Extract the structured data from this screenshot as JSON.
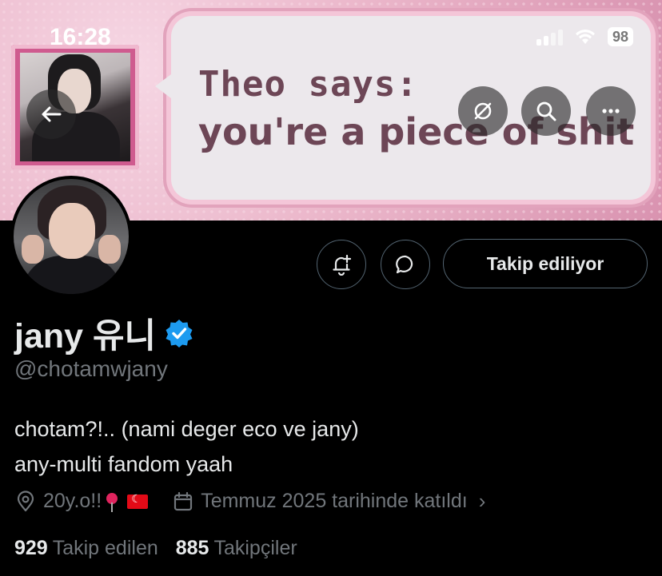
{
  "status_bar": {
    "time": "16:28",
    "battery": "98"
  },
  "banner": {
    "line1": "Theo says:",
    "line2": "you're a piece of shit"
  },
  "header_buttons": {
    "back_icon": "arrow-left-icon",
    "translate_icon": "grok-icon",
    "search_icon": "search-icon",
    "more_icon": "more-icon"
  },
  "actions": {
    "notify_icon": "bell-plus-icon",
    "message_icon": "message-bubble-icon",
    "follow_label": "Takip ediliyor"
  },
  "profile": {
    "display_name": "jany 유니",
    "verified": true,
    "handle": "@chotamwjany",
    "bio_line1": "chotam?!.. (nami deger eco ve jany)",
    "bio_line2": "any-multi fandom yaah",
    "location": "20y.o!!",
    "joined": "Temmuz 2025 tarihinde katıldı"
  },
  "stats": {
    "following_count": "929",
    "following_label": "Takip edilen",
    "followers_count": "885",
    "followers_label": "Takipçiler"
  },
  "colors": {
    "verified": "#1d9bf0",
    "muted": "#71767b",
    "border": "#536471"
  }
}
